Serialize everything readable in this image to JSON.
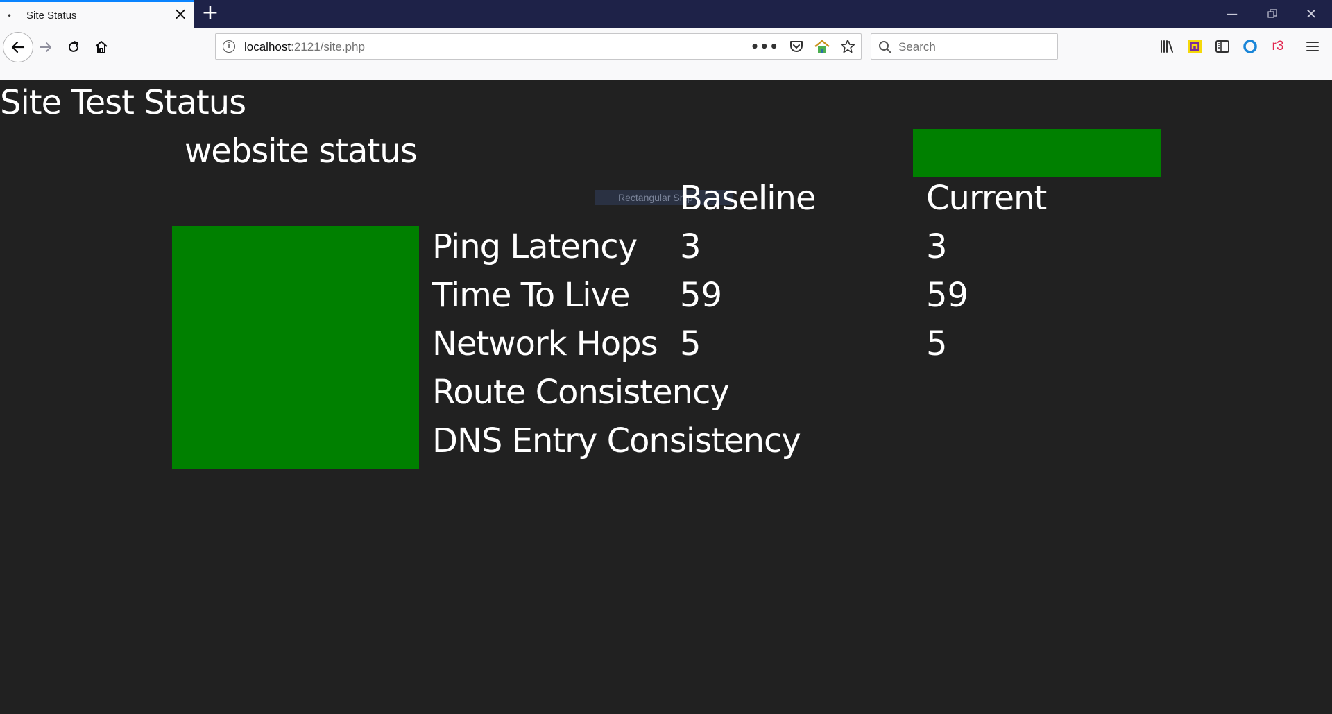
{
  "browser": {
    "tab": {
      "title": "Site Status"
    },
    "url": {
      "host": "localhost",
      "rest": ":2121/site.php"
    },
    "search": {
      "placeholder": "Search"
    },
    "extension_label": "r3"
  },
  "page": {
    "title": "Site Test Status",
    "section_title": "website status",
    "tooltip": "Rectangular Snip",
    "columns": {
      "baseline": "Baseline",
      "current": "Current"
    },
    "status_color": "#008000",
    "metrics": [
      {
        "label": "Ping Latency",
        "baseline": "3",
        "current": "3"
      },
      {
        "label": "Time To Live",
        "baseline": "59",
        "current": "59"
      },
      {
        "label": "Network Hops",
        "baseline": "5",
        "current": "5"
      },
      {
        "label": "Route Consistency",
        "baseline": "",
        "current": ""
      },
      {
        "label": "DNS Entry Consistency",
        "baseline": "",
        "current": ""
      }
    ]
  }
}
